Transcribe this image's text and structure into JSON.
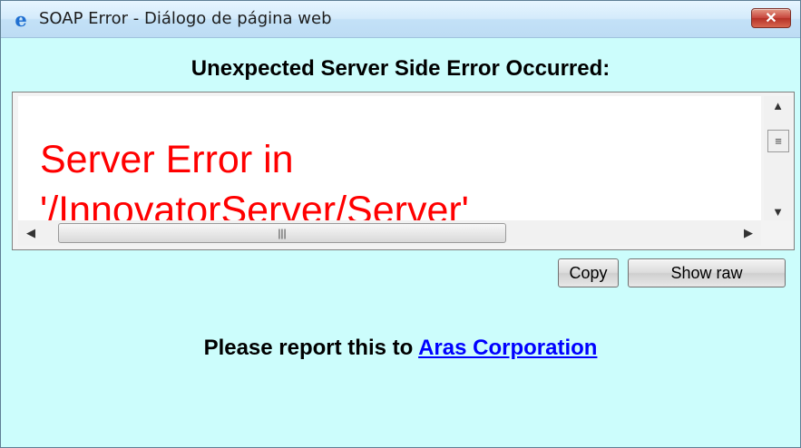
{
  "window": {
    "title": "SOAP Error - Diálogo de página web",
    "close_label": "✕",
    "icon": "ie-icon"
  },
  "dialog": {
    "heading": "Unexpected Server Side Error Occurred:",
    "error_line_1": "Server Error in",
    "error_line_2": "'/InnovatorServer/Server'",
    "scrollbar": {
      "up_icon": "▲",
      "down_icon": "▼",
      "left_icon": "◀",
      "right_icon": "▶",
      "thumb_grip": "|||",
      "v_thumb_grip": "≡"
    },
    "buttons": {
      "copy": "Copy",
      "show_raw": "Show raw"
    },
    "report_prefix": "Please report this to ",
    "report_link": "Aras Corporation"
  },
  "colors": {
    "content_bg": "#ccfdfc",
    "error_text": "#ff0000",
    "link": "#0000ff"
  }
}
